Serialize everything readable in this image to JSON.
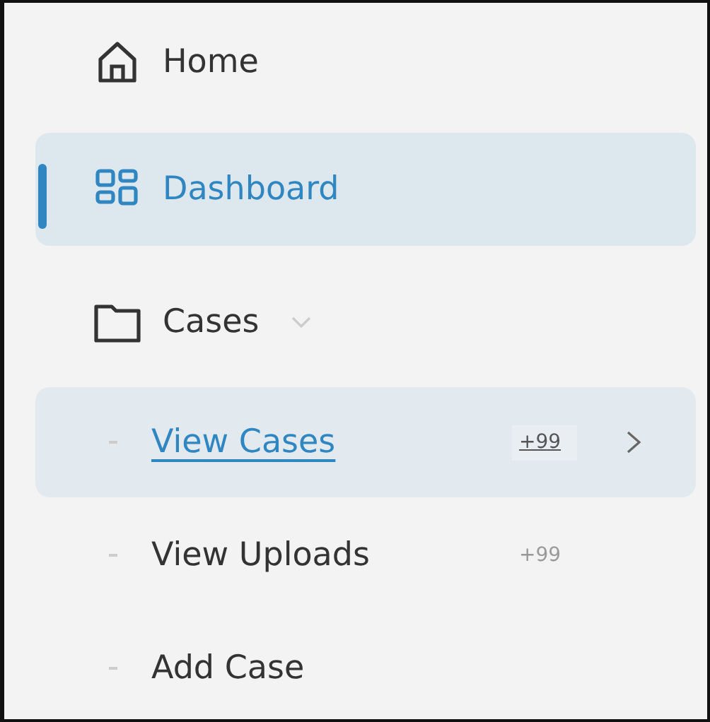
{
  "sidebar": {
    "items": [
      {
        "kind": "link",
        "label": "Home",
        "selected": false
      },
      {
        "kind": "link",
        "label": "Dashboard",
        "selected": true
      },
      {
        "kind": "group",
        "label": "Cases",
        "selected": false,
        "expanded": true,
        "children": [
          {
            "label": "View Cases",
            "badge": "+99",
            "selected": true
          },
          {
            "label": "View Uploads",
            "badge": "+99",
            "selected": false
          },
          {
            "label": "Add Case",
            "selected": false
          }
        ]
      }
    ]
  }
}
